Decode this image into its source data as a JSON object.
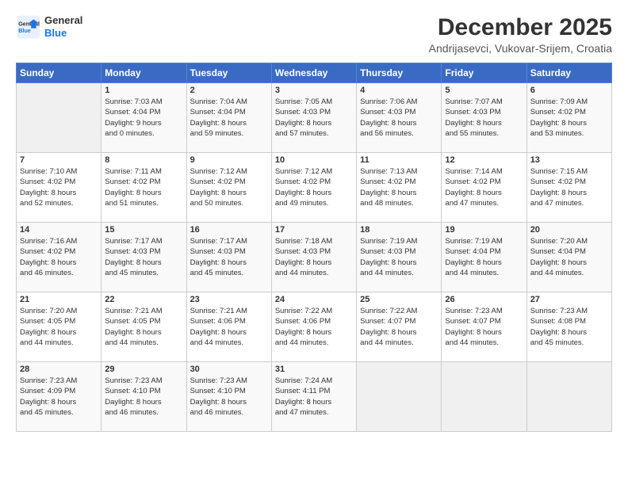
{
  "header": {
    "logo_line1": "General",
    "logo_line2": "Blue",
    "month_title": "December 2025",
    "location": "Andrijasevci, Vukovar-Srijem, Croatia"
  },
  "weekdays": [
    "Sunday",
    "Monday",
    "Tuesday",
    "Wednesday",
    "Thursday",
    "Friday",
    "Saturday"
  ],
  "weeks": [
    [
      {
        "day": "",
        "info": ""
      },
      {
        "day": "1",
        "info": "Sunrise: 7:03 AM\nSunset: 4:04 PM\nDaylight: 9 hours\nand 0 minutes."
      },
      {
        "day": "2",
        "info": "Sunrise: 7:04 AM\nSunset: 4:04 PM\nDaylight: 8 hours\nand 59 minutes."
      },
      {
        "day": "3",
        "info": "Sunrise: 7:05 AM\nSunset: 4:03 PM\nDaylight: 8 hours\nand 57 minutes."
      },
      {
        "day": "4",
        "info": "Sunrise: 7:06 AM\nSunset: 4:03 PM\nDaylight: 8 hours\nand 56 minutes."
      },
      {
        "day": "5",
        "info": "Sunrise: 7:07 AM\nSunset: 4:03 PM\nDaylight: 8 hours\nand 55 minutes."
      },
      {
        "day": "6",
        "info": "Sunrise: 7:09 AM\nSunset: 4:02 PM\nDaylight: 8 hours\nand 53 minutes."
      }
    ],
    [
      {
        "day": "7",
        "info": "Sunrise: 7:10 AM\nSunset: 4:02 PM\nDaylight: 8 hours\nand 52 minutes."
      },
      {
        "day": "8",
        "info": "Sunrise: 7:11 AM\nSunset: 4:02 PM\nDaylight: 8 hours\nand 51 minutes."
      },
      {
        "day": "9",
        "info": "Sunrise: 7:12 AM\nSunset: 4:02 PM\nDaylight: 8 hours\nand 50 minutes."
      },
      {
        "day": "10",
        "info": "Sunrise: 7:12 AM\nSunset: 4:02 PM\nDaylight: 8 hours\nand 49 minutes."
      },
      {
        "day": "11",
        "info": "Sunrise: 7:13 AM\nSunset: 4:02 PM\nDaylight: 8 hours\nand 48 minutes."
      },
      {
        "day": "12",
        "info": "Sunrise: 7:14 AM\nSunset: 4:02 PM\nDaylight: 8 hours\nand 47 minutes."
      },
      {
        "day": "13",
        "info": "Sunrise: 7:15 AM\nSunset: 4:02 PM\nDaylight: 8 hours\nand 47 minutes."
      }
    ],
    [
      {
        "day": "14",
        "info": "Sunrise: 7:16 AM\nSunset: 4:02 PM\nDaylight: 8 hours\nand 46 minutes."
      },
      {
        "day": "15",
        "info": "Sunrise: 7:17 AM\nSunset: 4:03 PM\nDaylight: 8 hours\nand 45 minutes."
      },
      {
        "day": "16",
        "info": "Sunrise: 7:17 AM\nSunset: 4:03 PM\nDaylight: 8 hours\nand 45 minutes."
      },
      {
        "day": "17",
        "info": "Sunrise: 7:18 AM\nSunset: 4:03 PM\nDaylight: 8 hours\nand 44 minutes."
      },
      {
        "day": "18",
        "info": "Sunrise: 7:19 AM\nSunset: 4:03 PM\nDaylight: 8 hours\nand 44 minutes."
      },
      {
        "day": "19",
        "info": "Sunrise: 7:19 AM\nSunset: 4:04 PM\nDaylight: 8 hours\nand 44 minutes."
      },
      {
        "day": "20",
        "info": "Sunrise: 7:20 AM\nSunset: 4:04 PM\nDaylight: 8 hours\nand 44 minutes."
      }
    ],
    [
      {
        "day": "21",
        "info": "Sunrise: 7:20 AM\nSunset: 4:05 PM\nDaylight: 8 hours\nand 44 minutes."
      },
      {
        "day": "22",
        "info": "Sunrise: 7:21 AM\nSunset: 4:05 PM\nDaylight: 8 hours\nand 44 minutes."
      },
      {
        "day": "23",
        "info": "Sunrise: 7:21 AM\nSunset: 4:06 PM\nDaylight: 8 hours\nand 44 minutes."
      },
      {
        "day": "24",
        "info": "Sunrise: 7:22 AM\nSunset: 4:06 PM\nDaylight: 8 hours\nand 44 minutes."
      },
      {
        "day": "25",
        "info": "Sunrise: 7:22 AM\nSunset: 4:07 PM\nDaylight: 8 hours\nand 44 minutes."
      },
      {
        "day": "26",
        "info": "Sunrise: 7:23 AM\nSunset: 4:07 PM\nDaylight: 8 hours\nand 44 minutes."
      },
      {
        "day": "27",
        "info": "Sunrise: 7:23 AM\nSunset: 4:08 PM\nDaylight: 8 hours\nand 45 minutes."
      }
    ],
    [
      {
        "day": "28",
        "info": "Sunrise: 7:23 AM\nSunset: 4:09 PM\nDaylight: 8 hours\nand 45 minutes."
      },
      {
        "day": "29",
        "info": "Sunrise: 7:23 AM\nSunset: 4:10 PM\nDaylight: 8 hours\nand 46 minutes."
      },
      {
        "day": "30",
        "info": "Sunrise: 7:23 AM\nSunset: 4:10 PM\nDaylight: 8 hours\nand 46 minutes."
      },
      {
        "day": "31",
        "info": "Sunrise: 7:24 AM\nSunset: 4:11 PM\nDaylight: 8 hours\nand 47 minutes."
      },
      {
        "day": "",
        "info": ""
      },
      {
        "day": "",
        "info": ""
      },
      {
        "day": "",
        "info": ""
      }
    ]
  ]
}
